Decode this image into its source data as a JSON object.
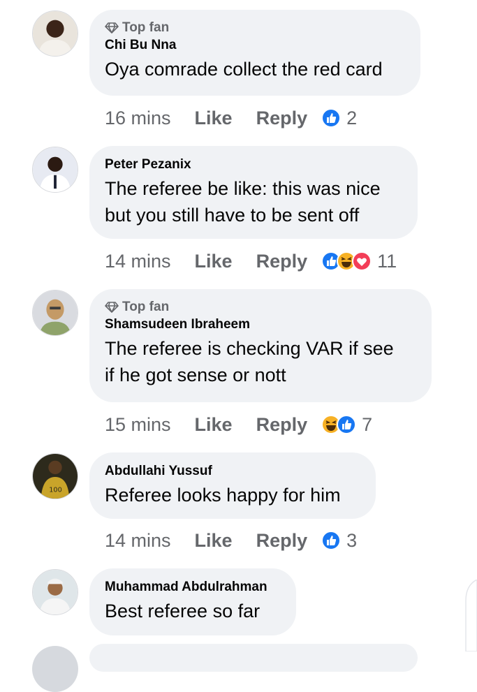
{
  "comments": [
    {
      "badge": "Top fan",
      "author": "Chi Bu Nna",
      "text_lines": [
        "Oya comrade collect the red card"
      ],
      "time": "16 mins",
      "like_label": "Like",
      "reply_label": "Reply",
      "reactions": [
        "like"
      ],
      "reaction_count": "2"
    },
    {
      "badge": "",
      "author": "Peter Pezanix",
      "text_lines": [
        "The referee be like: this was nice",
        "but you still have to be sent off"
      ],
      "time": "14 mins",
      "like_label": "Like",
      "reply_label": "Reply",
      "reactions": [
        "like",
        "haha",
        "love"
      ],
      "reaction_count": "11"
    },
    {
      "badge": "Top fan",
      "author": "Shamsudeen Ibraheem",
      "text_lines": [
        "The referee is checking VAR if see",
        "if he got sense or nott"
      ],
      "time": "15 mins",
      "like_label": "Like",
      "reply_label": "Reply",
      "reactions": [
        "haha",
        "like"
      ],
      "reaction_count": "7"
    },
    {
      "badge": "",
      "author": "Abdullahi Yussuf",
      "text_lines": [
        "Referee looks happy for him"
      ],
      "time": "14 mins",
      "like_label": "Like",
      "reply_label": "Reply",
      "reactions": [
        "like"
      ],
      "reaction_count": "3"
    },
    {
      "badge": "",
      "author": "Muhammad Abdulrahman",
      "text_lines": [
        "Best referee so far"
      ]
    }
  ],
  "colors": {
    "bubble": "#f0f2f5",
    "meta_text": "#65676b",
    "like_blue": "#1877f2",
    "love_red": "#f33e58",
    "haha_yellow": "#f7b125"
  },
  "icons": {
    "badge": "diamond-icon",
    "reactions": [
      "like-reaction-icon",
      "haha-reaction-icon",
      "love-reaction-icon"
    ]
  }
}
